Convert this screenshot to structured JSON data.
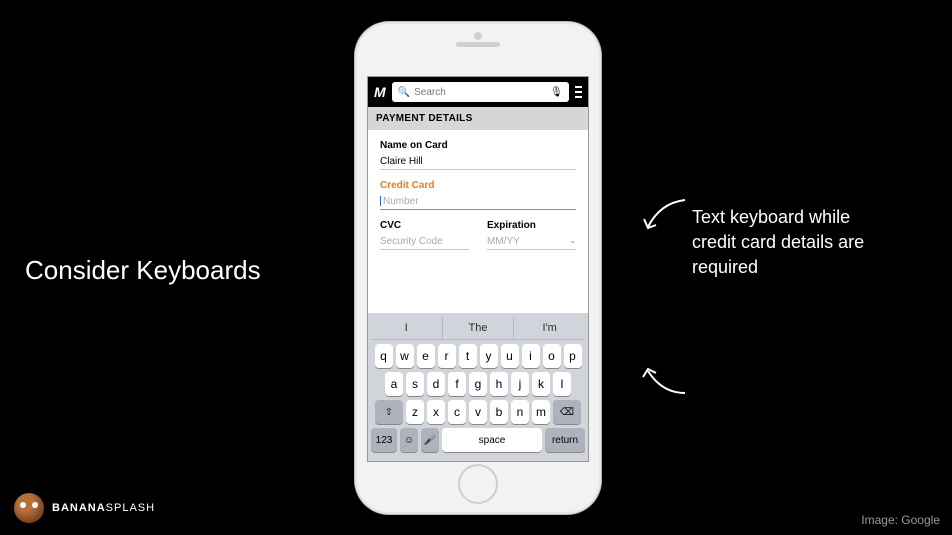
{
  "slide": {
    "title": "Consider Keyboards",
    "annotation": "Text keyboard while credit card details are required",
    "credit": "Image: Google",
    "brand1": "BANANA",
    "brand2": "SPLASH"
  },
  "app": {
    "logo": "M",
    "search_placeholder": "Search",
    "section": "PAYMENT DETAILS",
    "name_label": "Name on Card",
    "name_value": "Claire Hill",
    "cc_label": "Credit Card",
    "cc_placeholder": "Number",
    "cvc_label": "CVC",
    "cvc_placeholder": "Security Code",
    "exp_label": "Expiration",
    "exp_placeholder": "MM/YY"
  },
  "keyboard": {
    "suggest": [
      "I",
      "The",
      "I'm"
    ],
    "row1": [
      "q",
      "w",
      "e",
      "r",
      "t",
      "y",
      "u",
      "i",
      "o",
      "p"
    ],
    "row2": [
      "a",
      "s",
      "d",
      "f",
      "g",
      "h",
      "j",
      "k",
      "l"
    ],
    "row3": [
      "z",
      "x",
      "c",
      "v",
      "b",
      "n",
      "m"
    ],
    "shift": "⇧",
    "backspace": "⌫",
    "numkey": "123",
    "emoji": "☺",
    "mic": "🎤",
    "space": "space",
    "return": "return"
  }
}
